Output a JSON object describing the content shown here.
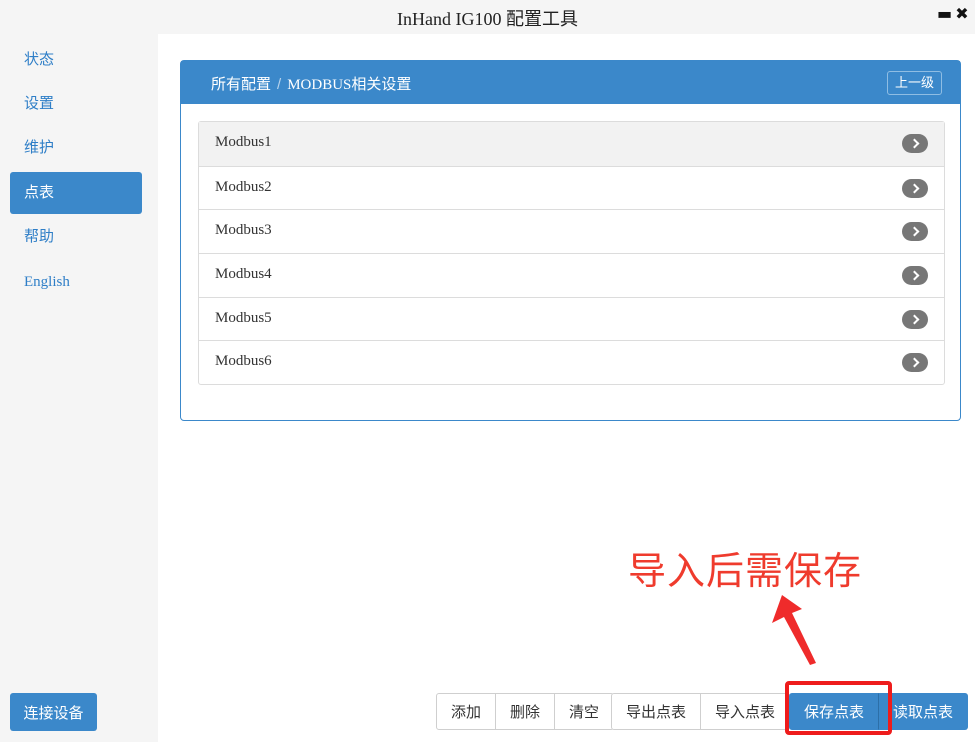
{
  "window": {
    "title": "InHand IG100 配置工具",
    "minimize_glyph": "▬",
    "close_glyph": "✖"
  },
  "sidebar": {
    "items": [
      {
        "label": "状态",
        "active": false
      },
      {
        "label": "设置",
        "active": false
      },
      {
        "label": "维护",
        "active": false
      },
      {
        "label": "点表",
        "active": true
      },
      {
        "label": "帮助",
        "active": false
      },
      {
        "label": "English",
        "active": false
      }
    ],
    "connect_label": "连接设备"
  },
  "panel": {
    "breadcrumb_root": "所有配置",
    "breadcrumb_separator": "/",
    "breadcrumb_current": "MODBUS相关设置",
    "up_label": "上一级",
    "rows": [
      "Modbus1",
      "Modbus2",
      "Modbus3",
      "Modbus4",
      "Modbus5",
      "Modbus6"
    ]
  },
  "toolbar": {
    "add_label": "添加",
    "delete_label": "删除",
    "clear_label": "清空",
    "export_label": "导出点表",
    "import_label": "导入点表",
    "save_label": "保存点表",
    "read_label": "读取点表"
  },
  "annotation": {
    "text": "导入后需保存",
    "color": "#ef3b2d"
  },
  "colors": {
    "accent": "#3b88ca",
    "highlight": "#ee1c1c"
  }
}
